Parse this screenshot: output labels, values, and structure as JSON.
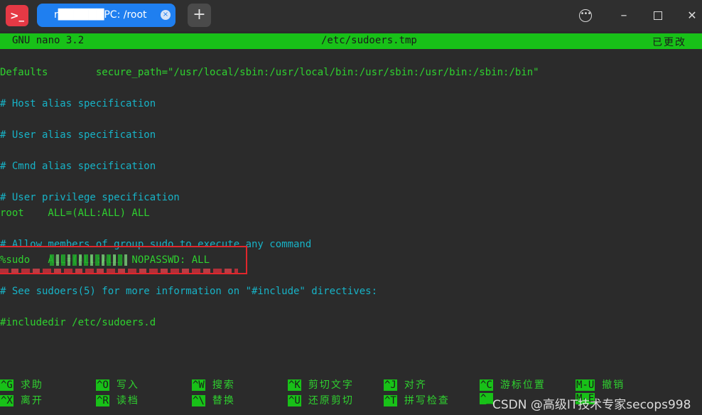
{
  "window": {
    "tab_title": "r██████PC: /root",
    "tab_close": "×",
    "new_tab": "+",
    "more_icon": "•••",
    "minimize_icon": "–",
    "close_icon": "✕",
    "app_icon": ">_"
  },
  "nano": {
    "version": "GNU nano 3.2",
    "filename": "/etc/sudoers.tmp",
    "status": "已更改"
  },
  "content_lines": [
    {
      "text": "Defaults        secure_path=\"/usr/local/sbin:/usr/local/bin:/usr/sbin:/usr/bin:/sbin:/bin\"",
      "kind": "code"
    },
    {
      "text": "",
      "kind": "code"
    },
    {
      "text": "# Host alias specification",
      "kind": "comment"
    },
    {
      "text": "",
      "kind": "code"
    },
    {
      "text": "# User alias specification",
      "kind": "comment"
    },
    {
      "text": "",
      "kind": "code"
    },
    {
      "text": "# Cmnd alias specification",
      "kind": "comment"
    },
    {
      "text": "",
      "kind": "code"
    },
    {
      "text": "# User privilege specification",
      "kind": "comment"
    },
    {
      "text": "root    ALL=(ALL:ALL) ALL",
      "kind": "code"
    },
    {
      "text": "",
      "kind": "code"
    },
    {
      "text": "# Allow members of group sudo to execute any command",
      "kind": "comment"
    },
    {
      "text": "%sudo   ALL=(ALL:ALL) NOPASSWD: ALL",
      "kind": "code"
    },
    {
      "text": "",
      "kind": "code"
    },
    {
      "text": "# See sudoers(5) for more information on \"#include\" directives:",
      "kind": "comment"
    },
    {
      "text": "",
      "kind": "code"
    },
    {
      "text": "#includedir /etc/sudoers.d",
      "kind": "code"
    }
  ],
  "shortcuts": [
    {
      "key": "^G",
      "label": "求助"
    },
    {
      "key": "^X",
      "label": "离开"
    },
    {
      "key": "^O",
      "label": "写入"
    },
    {
      "key": "^R",
      "label": "读档"
    },
    {
      "key": "^W",
      "label": "搜索"
    },
    {
      "key": "^\\",
      "label": "替换"
    },
    {
      "key": "^K",
      "label": "剪切文字"
    },
    {
      "key": "^U",
      "label": "还原剪切"
    },
    {
      "key": "^J",
      "label": "对齐"
    },
    {
      "key": "^T",
      "label": "拼写检查"
    },
    {
      "key": "^C",
      "label": "游标位置"
    },
    {
      "key": "^_",
      "label": ""
    },
    {
      "key": "M-U",
      "label": "撤销"
    },
    {
      "key": "M-E",
      "label": ""
    }
  ],
  "watermark": "CSDN @高级IT技术专家secops998",
  "colors": {
    "terminal_bg": "#2b2b2b",
    "nano_green": "#18c118",
    "text_green": "#2fd12f",
    "comment_cyan": "#17b3c7",
    "tab_blue": "#1f7ff0",
    "annotation_red": "#e0262c"
  }
}
